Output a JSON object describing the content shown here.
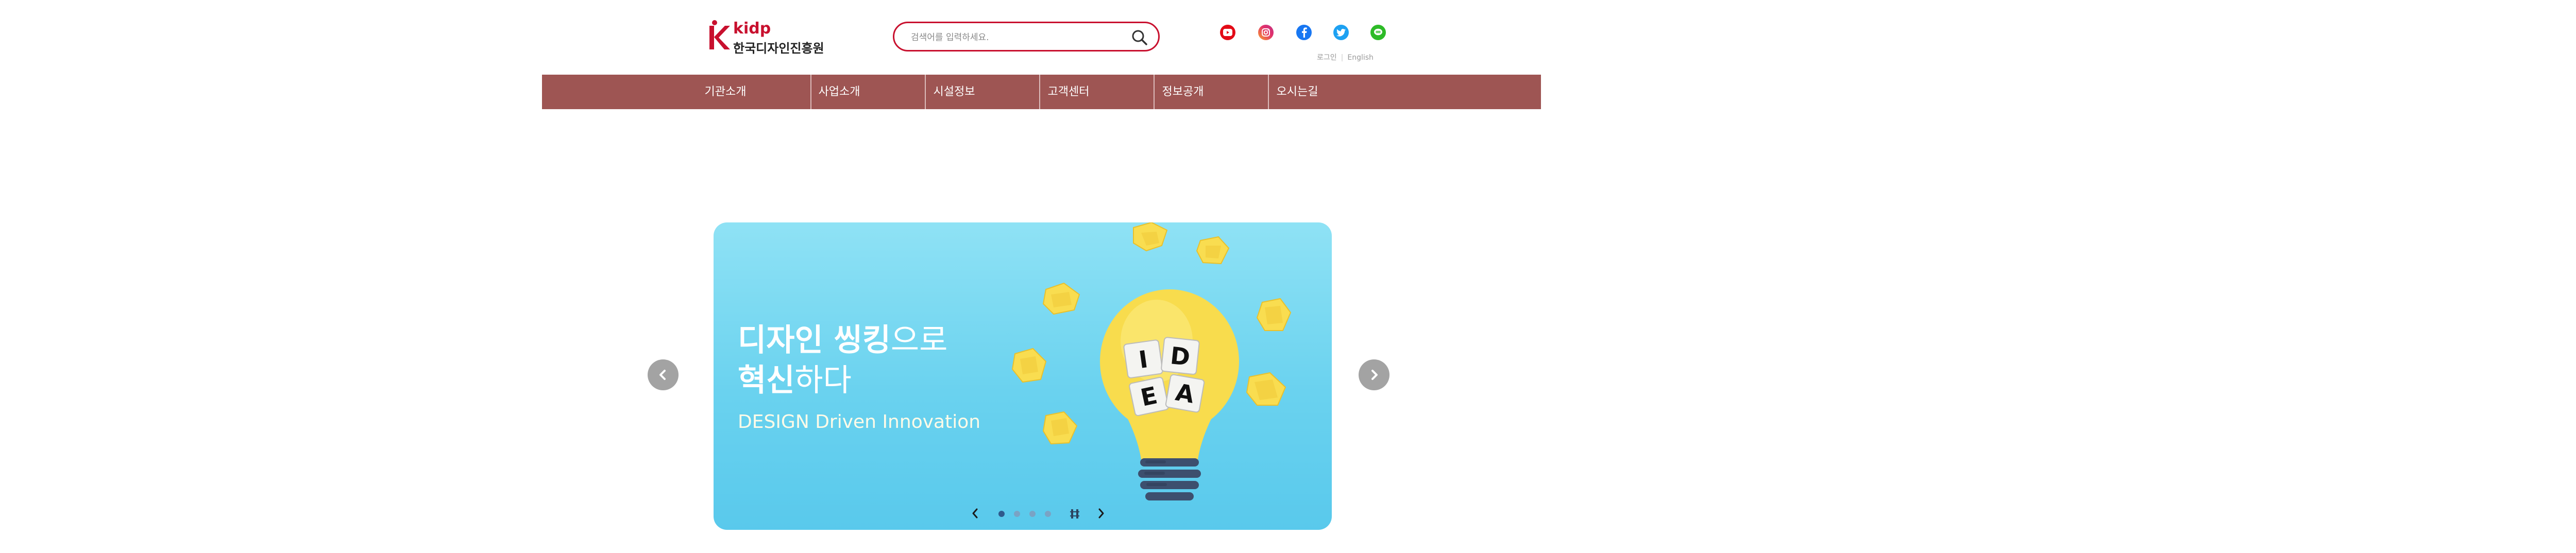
{
  "header": {
    "logo": {
      "brand": "kidp",
      "name": "한국디자인진흥원"
    },
    "search": {
      "placeholder": "검색어를 입력하세요."
    },
    "social": [
      "youtube-icon",
      "instagram-icon",
      "facebook-icon",
      "twitter-icon",
      "line-icon"
    ],
    "util_links": {
      "login": "로그인",
      "english": "English"
    }
  },
  "nav": {
    "items": [
      {
        "label": "기관소개"
      },
      {
        "label": "사업소개"
      },
      {
        "label": "시설정보"
      },
      {
        "label": "고객센터"
      },
      {
        "label": "정보공개"
      },
      {
        "label": "오시는길"
      }
    ]
  },
  "banner": {
    "title_line1_bold": "디자인 씽킹",
    "title_line1_rest": "으로",
    "title_line2_bold": "혁신",
    "title_line2_rest": "하다",
    "subtitle": "DESIGN Driven Innovation",
    "blocks": [
      "I",
      "D",
      "E",
      "A"
    ],
    "active_slide": 1,
    "slide_count": 4
  },
  "colors": {
    "brand_red": "#c8102e",
    "nav_bg": "#9e5553",
    "banner_bg": "#6ad2ef",
    "bulb_yellow": "#f8dc4d"
  }
}
